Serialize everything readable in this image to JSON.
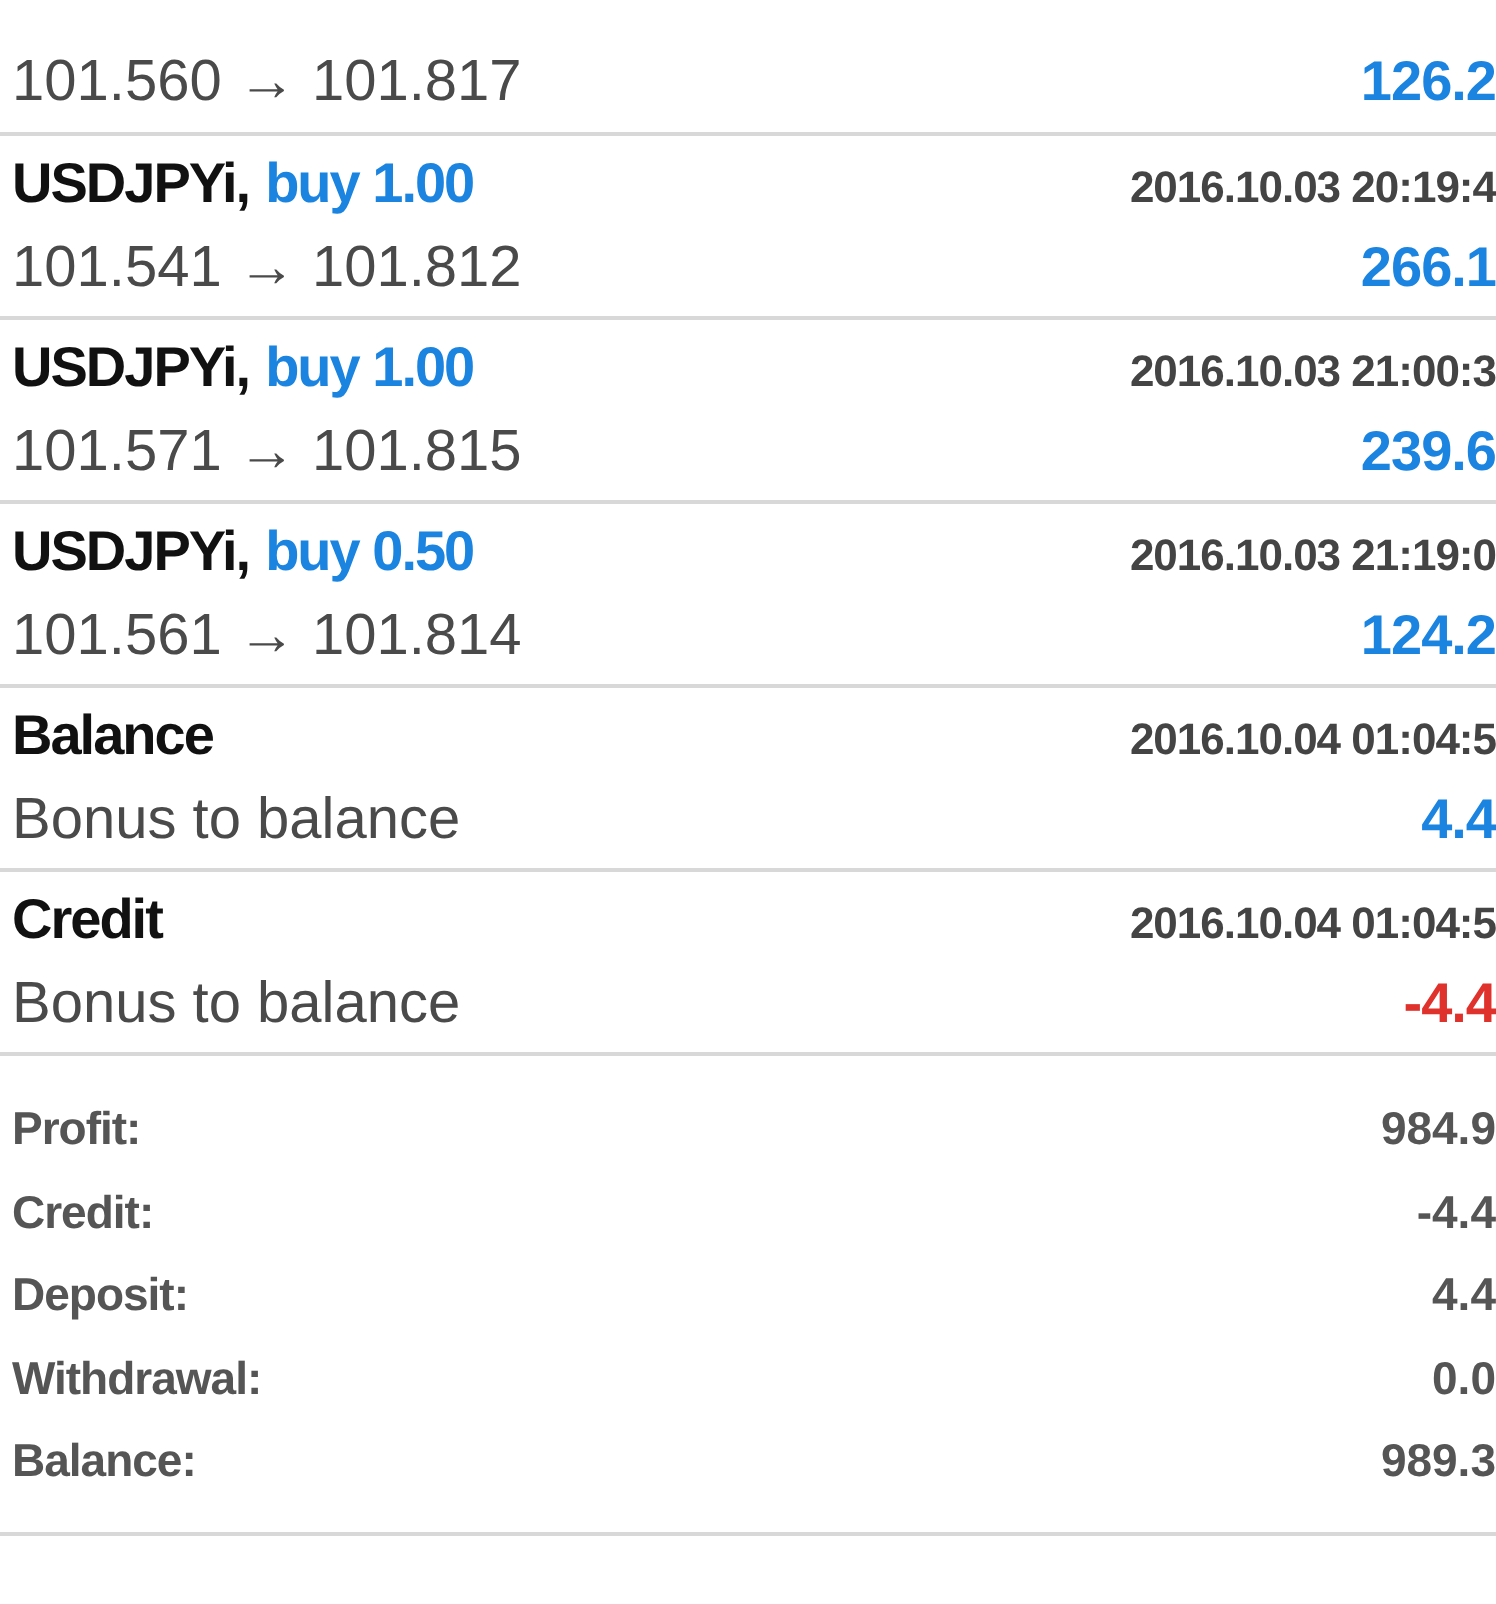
{
  "history": [
    {
      "kind": "trade",
      "prices": "101.560 → 101.817",
      "profit": "126.2",
      "negative": false
    },
    {
      "kind": "trade",
      "symbol": "USDJPYi,",
      "action": "buy 1.00",
      "time": "2016.10.03 20:19:4",
      "prices": "101.541 → 101.812",
      "profit": "266.1",
      "negative": false
    },
    {
      "kind": "trade",
      "symbol": "USDJPYi,",
      "action": "buy 1.00",
      "time": "2016.10.03 21:00:3",
      "prices": "101.571 → 101.815",
      "profit": "239.6",
      "negative": false
    },
    {
      "kind": "trade",
      "symbol": "USDJPYi,",
      "action": "buy 0.50",
      "time": "2016.10.03 21:19:0",
      "prices": "101.561 → 101.814",
      "profit": "124.2",
      "negative": false
    },
    {
      "kind": "balance",
      "symbol": "Balance",
      "time": "2016.10.04 01:04:5",
      "prices": "Bonus to balance",
      "profit": "4.4",
      "negative": false
    },
    {
      "kind": "balance",
      "symbol": "Credit",
      "time": "2016.10.04 01:04:5",
      "prices": "Bonus to balance",
      "profit": "-4.4",
      "negative": true
    }
  ],
  "summary": [
    {
      "label": "Profit:",
      "value": "984.9"
    },
    {
      "label": "Credit:",
      "value": "-4.4"
    },
    {
      "label": "Deposit:",
      "value": "4.4"
    },
    {
      "label": "Withdrawal:",
      "value": "0.0"
    },
    {
      "label": "Balance:",
      "value": "989.3"
    }
  ]
}
